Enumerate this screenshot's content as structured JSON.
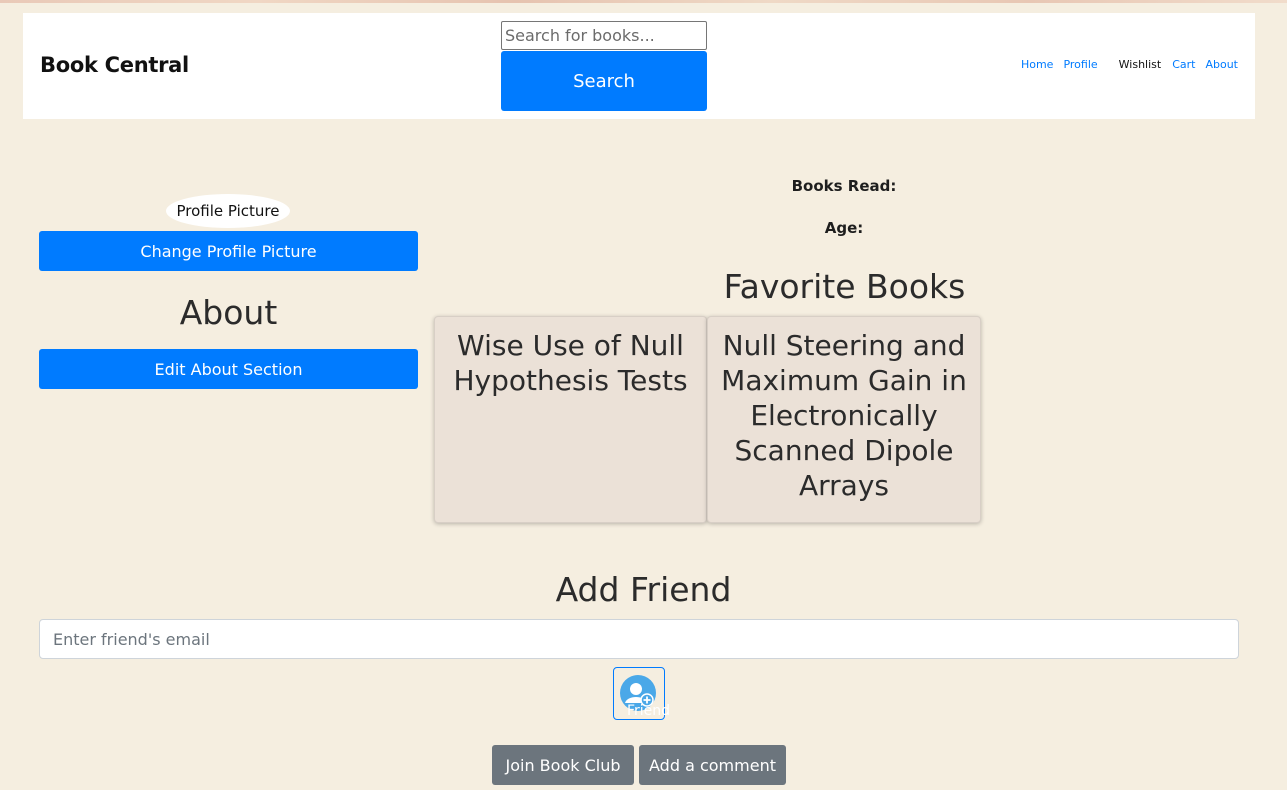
{
  "navbar": {
    "brand": "Book Central",
    "search_placeholder": "Search for books...",
    "search_button": "Search",
    "links": [
      {
        "label": "Home"
      },
      {
        "label": "Profile"
      },
      {
        "label": "Wishlist"
      },
      {
        "label": "Cart"
      },
      {
        "label": "About"
      }
    ]
  },
  "profile": {
    "picture_alt": "Profile Picture",
    "change_picture_button": "Change Profile Picture",
    "about_heading": "About",
    "edit_about_button": "Edit About Section",
    "books_read_label": "Books Read:",
    "age_label": "Age:"
  },
  "favorites": {
    "heading": "Favorite Books",
    "books": [
      {
        "title": "Wise Use of Null Hypothesis Tests"
      },
      {
        "title": "Null Steering and Maximum Gain in Electronically Scanned Dipole Arrays"
      }
    ]
  },
  "friends": {
    "heading": "Add Friend",
    "email_placeholder": "Enter friend's email",
    "add_button_label": "Friend",
    "add_button_icon": "add-user-icon"
  },
  "actions": {
    "join_book_club": "Join Book Club",
    "add_comment": "Add a comment"
  },
  "colors": {
    "background": "#f5eee0",
    "primary": "#007bff",
    "secondary": "#6c757d",
    "card": "#ebe1d7"
  }
}
